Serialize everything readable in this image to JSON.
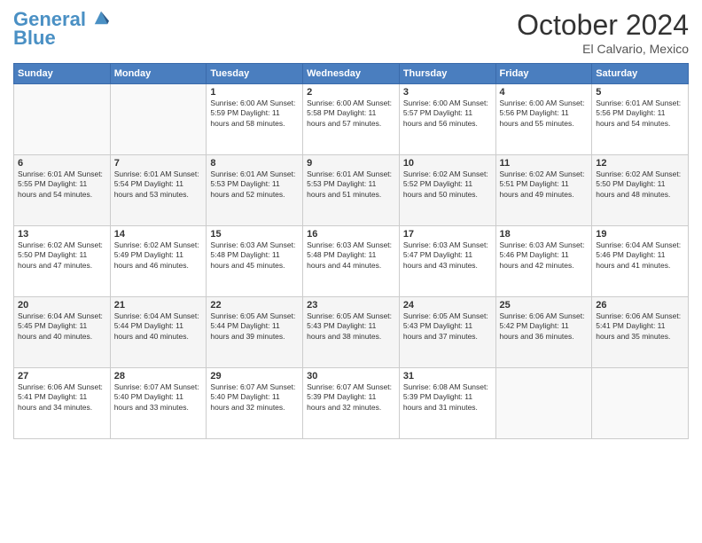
{
  "header": {
    "logo_line1": "General",
    "logo_line2": "Blue",
    "month": "October 2024",
    "location": "El Calvario, Mexico"
  },
  "days_of_week": [
    "Sunday",
    "Monday",
    "Tuesday",
    "Wednesday",
    "Thursday",
    "Friday",
    "Saturday"
  ],
  "weeks": [
    [
      {
        "day": "",
        "info": ""
      },
      {
        "day": "",
        "info": ""
      },
      {
        "day": "1",
        "info": "Sunrise: 6:00 AM\nSunset: 5:59 PM\nDaylight: 11 hours\nand 58 minutes."
      },
      {
        "day": "2",
        "info": "Sunrise: 6:00 AM\nSunset: 5:58 PM\nDaylight: 11 hours\nand 57 minutes."
      },
      {
        "day": "3",
        "info": "Sunrise: 6:00 AM\nSunset: 5:57 PM\nDaylight: 11 hours\nand 56 minutes."
      },
      {
        "day": "4",
        "info": "Sunrise: 6:00 AM\nSunset: 5:56 PM\nDaylight: 11 hours\nand 55 minutes."
      },
      {
        "day": "5",
        "info": "Sunrise: 6:01 AM\nSunset: 5:56 PM\nDaylight: 11 hours\nand 54 minutes."
      }
    ],
    [
      {
        "day": "6",
        "info": "Sunrise: 6:01 AM\nSunset: 5:55 PM\nDaylight: 11 hours\nand 54 minutes."
      },
      {
        "day": "7",
        "info": "Sunrise: 6:01 AM\nSunset: 5:54 PM\nDaylight: 11 hours\nand 53 minutes."
      },
      {
        "day": "8",
        "info": "Sunrise: 6:01 AM\nSunset: 5:53 PM\nDaylight: 11 hours\nand 52 minutes."
      },
      {
        "day": "9",
        "info": "Sunrise: 6:01 AM\nSunset: 5:53 PM\nDaylight: 11 hours\nand 51 minutes."
      },
      {
        "day": "10",
        "info": "Sunrise: 6:02 AM\nSunset: 5:52 PM\nDaylight: 11 hours\nand 50 minutes."
      },
      {
        "day": "11",
        "info": "Sunrise: 6:02 AM\nSunset: 5:51 PM\nDaylight: 11 hours\nand 49 minutes."
      },
      {
        "day": "12",
        "info": "Sunrise: 6:02 AM\nSunset: 5:50 PM\nDaylight: 11 hours\nand 48 minutes."
      }
    ],
    [
      {
        "day": "13",
        "info": "Sunrise: 6:02 AM\nSunset: 5:50 PM\nDaylight: 11 hours\nand 47 minutes."
      },
      {
        "day": "14",
        "info": "Sunrise: 6:02 AM\nSunset: 5:49 PM\nDaylight: 11 hours\nand 46 minutes."
      },
      {
        "day": "15",
        "info": "Sunrise: 6:03 AM\nSunset: 5:48 PM\nDaylight: 11 hours\nand 45 minutes."
      },
      {
        "day": "16",
        "info": "Sunrise: 6:03 AM\nSunset: 5:48 PM\nDaylight: 11 hours\nand 44 minutes."
      },
      {
        "day": "17",
        "info": "Sunrise: 6:03 AM\nSunset: 5:47 PM\nDaylight: 11 hours\nand 43 minutes."
      },
      {
        "day": "18",
        "info": "Sunrise: 6:03 AM\nSunset: 5:46 PM\nDaylight: 11 hours\nand 42 minutes."
      },
      {
        "day": "19",
        "info": "Sunrise: 6:04 AM\nSunset: 5:46 PM\nDaylight: 11 hours\nand 41 minutes."
      }
    ],
    [
      {
        "day": "20",
        "info": "Sunrise: 6:04 AM\nSunset: 5:45 PM\nDaylight: 11 hours\nand 40 minutes."
      },
      {
        "day": "21",
        "info": "Sunrise: 6:04 AM\nSunset: 5:44 PM\nDaylight: 11 hours\nand 40 minutes."
      },
      {
        "day": "22",
        "info": "Sunrise: 6:05 AM\nSunset: 5:44 PM\nDaylight: 11 hours\nand 39 minutes."
      },
      {
        "day": "23",
        "info": "Sunrise: 6:05 AM\nSunset: 5:43 PM\nDaylight: 11 hours\nand 38 minutes."
      },
      {
        "day": "24",
        "info": "Sunrise: 6:05 AM\nSunset: 5:43 PM\nDaylight: 11 hours\nand 37 minutes."
      },
      {
        "day": "25",
        "info": "Sunrise: 6:06 AM\nSunset: 5:42 PM\nDaylight: 11 hours\nand 36 minutes."
      },
      {
        "day": "26",
        "info": "Sunrise: 6:06 AM\nSunset: 5:41 PM\nDaylight: 11 hours\nand 35 minutes."
      }
    ],
    [
      {
        "day": "27",
        "info": "Sunrise: 6:06 AM\nSunset: 5:41 PM\nDaylight: 11 hours\nand 34 minutes."
      },
      {
        "day": "28",
        "info": "Sunrise: 6:07 AM\nSunset: 5:40 PM\nDaylight: 11 hours\nand 33 minutes."
      },
      {
        "day": "29",
        "info": "Sunrise: 6:07 AM\nSunset: 5:40 PM\nDaylight: 11 hours\nand 32 minutes."
      },
      {
        "day": "30",
        "info": "Sunrise: 6:07 AM\nSunset: 5:39 PM\nDaylight: 11 hours\nand 32 minutes."
      },
      {
        "day": "31",
        "info": "Sunrise: 6:08 AM\nSunset: 5:39 PM\nDaylight: 11 hours\nand 31 minutes."
      },
      {
        "day": "",
        "info": ""
      },
      {
        "day": "",
        "info": ""
      }
    ]
  ]
}
